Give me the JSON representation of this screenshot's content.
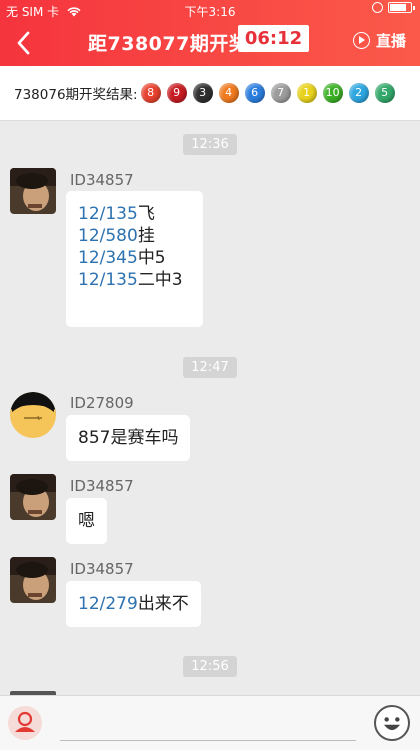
{
  "status_bar": {
    "carrier": "无 SIM 卡",
    "time": "下午3:16"
  },
  "nav": {
    "title": "距738077期开奖",
    "countdown": "06:12",
    "live_label": "直播"
  },
  "results": {
    "label": "738076期开奖结果:",
    "balls": [
      {
        "n": "8",
        "color": "#e8412f"
      },
      {
        "n": "9",
        "color": "#c71b22"
      },
      {
        "n": "3",
        "color": "#2f2f2f"
      },
      {
        "n": "4",
        "color": "#f07a1f"
      },
      {
        "n": "6",
        "color": "#2b7ede"
      },
      {
        "n": "7",
        "color": "#9c9c9c"
      },
      {
        "n": "1",
        "color": "#e8d21b"
      },
      {
        "n": "10",
        "color": "#3cb026"
      },
      {
        "n": "2",
        "color": "#2ea6e0"
      },
      {
        "n": "5",
        "color": "#32a86a"
      }
    ]
  },
  "chat": {
    "timestamps": [
      "12:36",
      "12:47",
      "12:56"
    ],
    "messages": [
      {
        "uid": "ID34857",
        "lines": [
          {
            "link": "12/135",
            "text": "飞"
          },
          {
            "link": "12/580",
            "text": "挂"
          },
          {
            "link": "12/345",
            "text": "中5"
          },
          {
            "link": "12/135",
            "text": "二中3"
          }
        ]
      },
      {
        "uid": "ID27809",
        "text": "857是赛车吗"
      },
      {
        "uid": "ID34857",
        "text": "嗯"
      },
      {
        "uid": "ID34857",
        "link": "12/279",
        "text": "出来不"
      }
    ]
  },
  "footer": {
    "input_placeholder": ""
  }
}
